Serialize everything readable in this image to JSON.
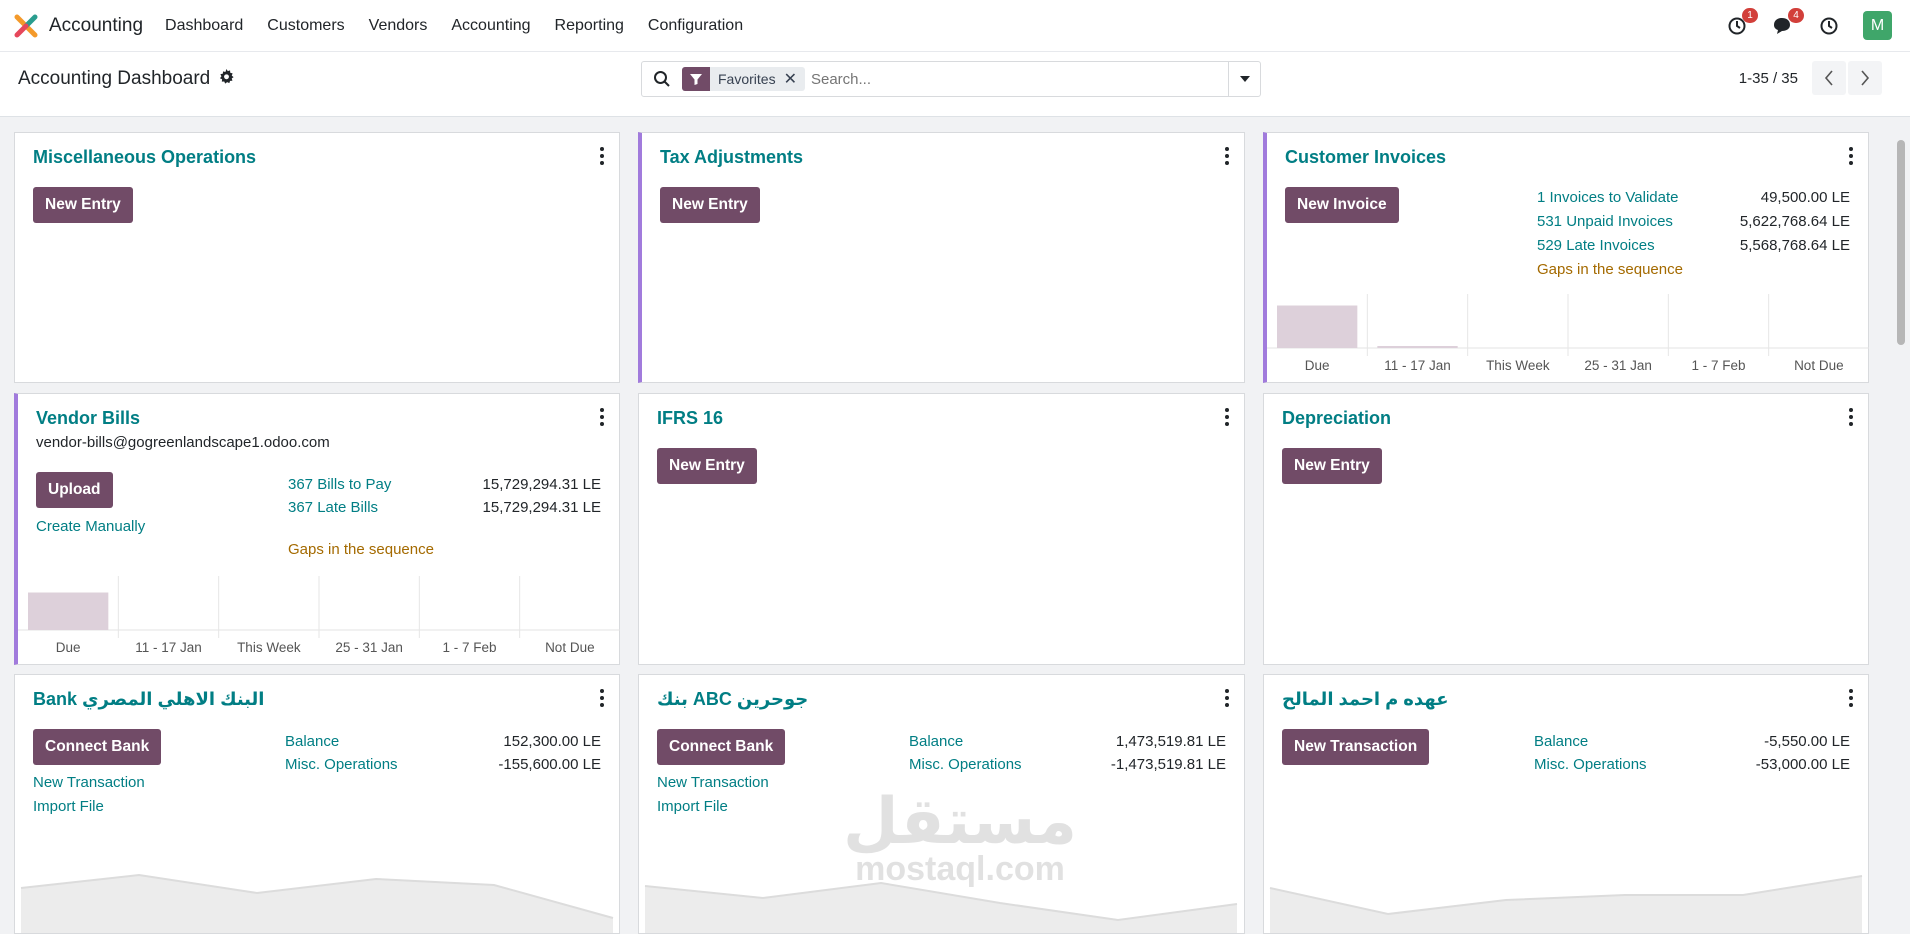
{
  "app": {
    "name": "Accounting",
    "menu": [
      "Dashboard",
      "Customers",
      "Vendors",
      "Accounting",
      "Reporting",
      "Configuration"
    ],
    "activity_count": "1",
    "messages_count": "4",
    "avatar_letter": "M"
  },
  "control": {
    "title": "Accounting Dashboard",
    "facet_label": "Favorites",
    "search_placeholder": "Search...",
    "pager": "1-35 / 35"
  },
  "chart_labels": [
    "Due",
    "11 - 17 Jan",
    "This Week",
    "25 - 31 Jan",
    "1 - 7 Feb",
    "Not Due"
  ],
  "cards": {
    "misc": {
      "title": "Miscellaneous Operations",
      "button": "New Entry"
    },
    "tax": {
      "title": "Tax Adjustments",
      "button": "New Entry"
    },
    "customer_invoices": {
      "title": "Customer Invoices",
      "button": "New Invoice",
      "stats": [
        {
          "label": "1 Invoices to Validate",
          "amount": "49,500.00 LE"
        },
        {
          "label": "531 Unpaid Invoices",
          "amount": "5,622,768.64 LE"
        },
        {
          "label": "529 Late Invoices",
          "amount": "5,568,768.64 LE"
        }
      ],
      "gaps": "Gaps in the sequence",
      "bars": [
        0.85,
        0.03,
        0,
        0,
        0,
        0
      ]
    },
    "vendor_bills": {
      "title": "Vendor Bills",
      "email": "vendor-bills@gogreenlandscape1.odoo.com",
      "button": "Upload",
      "create_manually": "Create Manually",
      "stats": [
        {
          "label": "367 Bills to Pay",
          "amount": "15,729,294.31 LE"
        },
        {
          "label": "367 Late Bills",
          "amount": "15,729,294.31 LE"
        }
      ],
      "gaps": "Gaps in the sequence",
      "bars": [
        0.75,
        0,
        0,
        0,
        0,
        0
      ]
    },
    "ifrs": {
      "title": "IFRS 16",
      "button": "New Entry"
    },
    "depreciation": {
      "title": "Depreciation",
      "button": "New Entry"
    },
    "bank1": {
      "title": "Bank البنك الاهلي المصري",
      "button": "Connect Bank",
      "new_transaction": "New Transaction",
      "import_file": "Import File",
      "balance_label": "Balance",
      "balance": "152,300.00 LE",
      "misc_label": "Misc. Operations",
      "misc": "-155,600.00 LE"
    },
    "bank2": {
      "title": "بنك ABC جوحرين",
      "button": "Connect Bank",
      "new_transaction": "New Transaction",
      "import_file": "Import File",
      "balance_label": "Balance",
      "balance": "1,473,519.81 LE",
      "misc_label": "Misc. Operations",
      "misc": "-1,473,519.81 LE"
    },
    "cash": {
      "title": "عهده م احمد المالح",
      "button": "New Transaction",
      "balance_label": "Balance",
      "balance": "-5,550.00 LE",
      "misc_label": "Misc. Operations",
      "misc": "-53,000.00 LE"
    }
  },
  "watermark": {
    "line1": "مستقل",
    "line2": "mostaql.com"
  },
  "colors": {
    "primary": "#714b67",
    "link": "#017e84",
    "warning": "#a46a00",
    "accent": "#a17bdc",
    "bar": "#ddd0da"
  }
}
